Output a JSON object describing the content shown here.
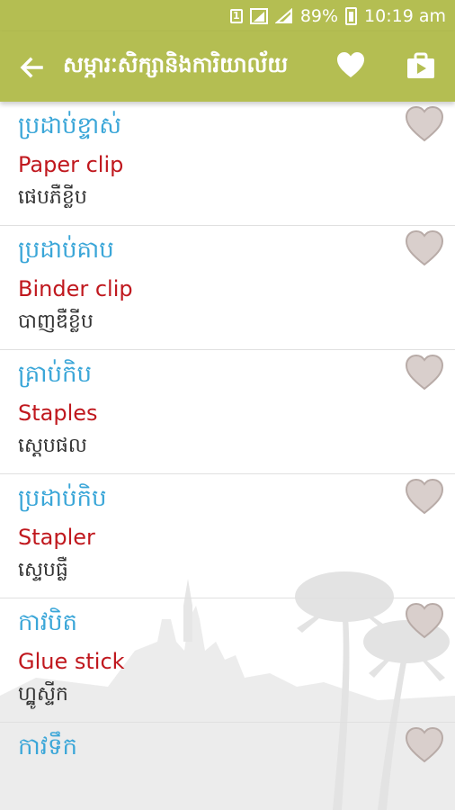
{
  "status": {
    "sim": "1",
    "battery": "89%",
    "time": "10:19 am"
  },
  "toolbar": {
    "title": "សម្ភារៈសិក្សានិងការិយាល័យ"
  },
  "items": [
    {
      "khmer": "ប្រដាប់ខ្ទាស់",
      "english": "Paper clip",
      "translit": "ផេបភឺខ្លីប"
    },
    {
      "khmer": "ប្រដាប់គាប",
      "english": "Binder clip",
      "translit": "បាញឌឺខ្លីប"
    },
    {
      "khmer": "គ្រាប់កិប",
      "english": "Staples",
      "translit": "ស្តេបផល"
    },
    {
      "khmer": "ប្រដាប់កិប",
      "english": "Stapler",
      "translit": "ស្ទេបធ្លឺ"
    },
    {
      "khmer": "កាវបិត",
      "english": "Glue stick",
      "translit": "ហ្គ្លូស្ទីក"
    },
    {
      "khmer": "កាវទឹក",
      "english": "",
      "translit": ""
    }
  ],
  "colors": {
    "primary": "#b4be52",
    "khmer_text": "#3aa6d8",
    "english_text": "#c0181e",
    "heart": "#d9cfcc"
  },
  "icons": {
    "back": "arrow-left-icon",
    "favorite": "heart-icon",
    "store": "store-bag-icon",
    "item_favorite": "heart-outline-icon"
  }
}
